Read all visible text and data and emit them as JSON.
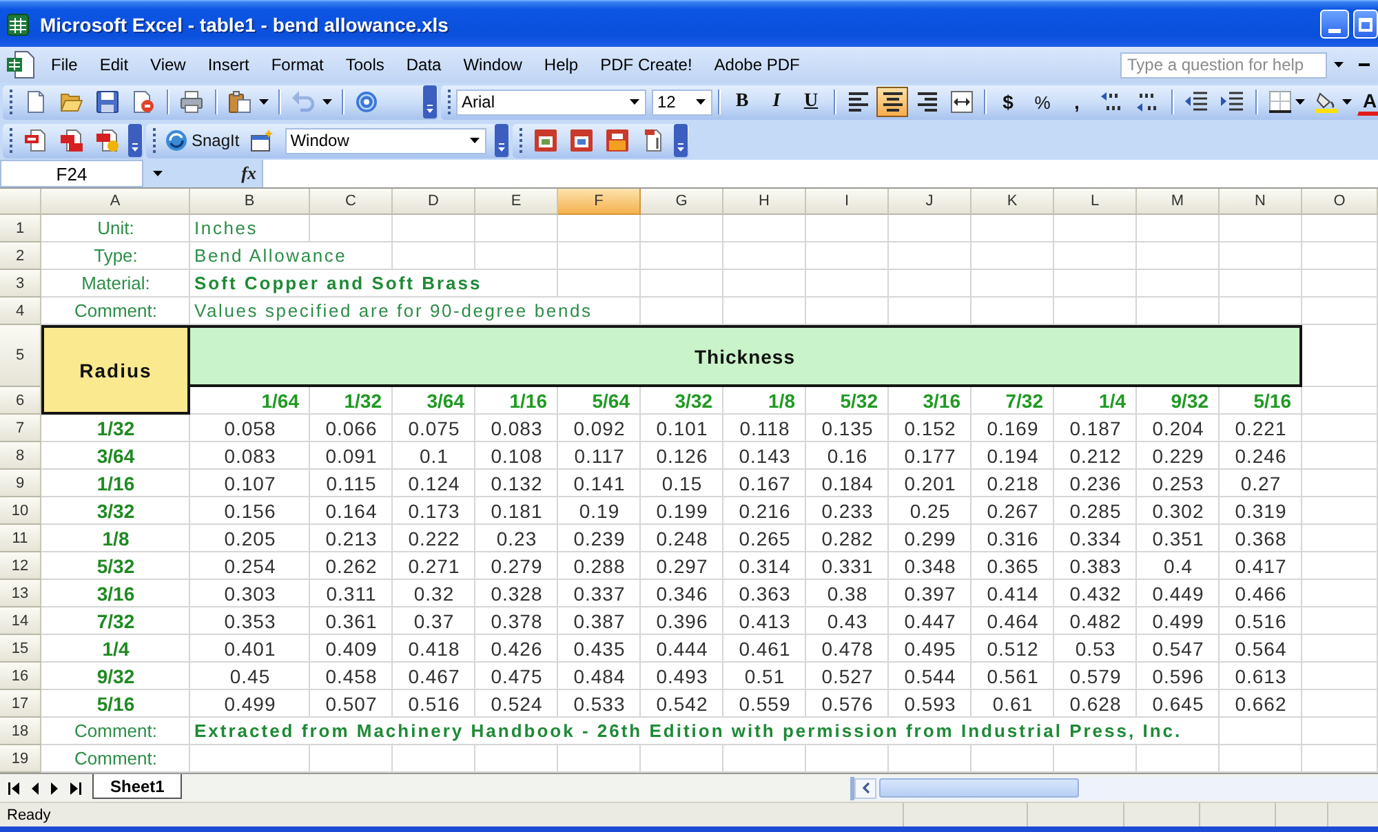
{
  "window": {
    "title": "Microsoft Excel - table1 - bend allowance.xls"
  },
  "menu_bar": {
    "items": [
      "File",
      "Edit",
      "View",
      "Insert",
      "Format",
      "Tools",
      "Data",
      "Window",
      "Help",
      "PDF Create!",
      "Adobe PDF"
    ],
    "help_box": {
      "placeholder": "Type a question for help"
    }
  },
  "standard_toolbar": {
    "undo": {
      "disabled": true
    }
  },
  "formatting_toolbar": {
    "font": "Arial",
    "font_size": "12",
    "style_buttons": [
      {
        "label": "B",
        "selected": false
      },
      {
        "label": "I",
        "selected": false
      },
      {
        "label": "U",
        "selected": false
      }
    ],
    "alignment_buttons": [
      {
        "kind": "left",
        "selected": false
      },
      {
        "kind": "center",
        "selected": true
      },
      {
        "kind": "right",
        "selected": false
      },
      {
        "kind": "merge",
        "selected": false
      }
    ],
    "number_buttons": [
      "$",
      "%",
      ","
    ],
    "font_color_button": "A"
  },
  "snagit_toolbar": {
    "label": "SnagIt",
    "capture_mode": "Window"
  },
  "formula_bar": {
    "name_box": "F24",
    "function_label": "fx"
  },
  "sheet": {
    "columns": [
      {
        "label": "A",
        "selected": false
      },
      {
        "label": "B",
        "selected": false
      },
      {
        "label": "C",
        "selected": false
      },
      {
        "label": "D",
        "selected": false
      },
      {
        "label": "E",
        "selected": false
      },
      {
        "label": "F",
        "selected": true
      },
      {
        "label": "G",
        "selected": false
      },
      {
        "label": "H",
        "selected": false
      },
      {
        "label": "I",
        "selected": false
      },
      {
        "label": "J",
        "selected": false
      },
      {
        "label": "K",
        "selected": false
      },
      {
        "label": "L",
        "selected": false
      },
      {
        "label": "M",
        "selected": false
      },
      {
        "label": "N",
        "selected": false
      },
      {
        "label": "O",
        "selected": false
      }
    ],
    "rows": [
      {
        "number": "1",
        "kind": "info",
        "label": "Unit:",
        "value": "Inches",
        "bold": false
      },
      {
        "number": "2",
        "kind": "info",
        "label": "Type:",
        "value": "Bend Allowance",
        "bold": false
      },
      {
        "number": "3",
        "kind": "info",
        "label": "Material:",
        "value": "Soft Copper and Soft Brass",
        "bold": true
      },
      {
        "number": "4",
        "kind": "info",
        "label": "Comment:",
        "value": "Values specified are for 90-degree bends",
        "bold": false
      },
      {
        "number": "5",
        "kind": "heading",
        "corner": "Radius",
        "title": "Thickness"
      },
      {
        "number": "6",
        "kind": "thickness",
        "values": [
          "1/64",
          "1/32",
          "3/64",
          "1/16",
          "5/64",
          "3/32",
          "1/8",
          "5/32",
          "3/16",
          "7/32",
          "1/4",
          "9/32",
          "5/16"
        ]
      },
      {
        "number": "7",
        "kind": "data",
        "radius": "1/32",
        "values": [
          "0.058",
          "0.066",
          "0.075",
          "0.083",
          "0.092",
          "0.101",
          "0.118",
          "0.135",
          "0.152",
          "0.169",
          "0.187",
          "0.204",
          "0.221"
        ]
      },
      {
        "number": "8",
        "kind": "data",
        "radius": "3/64",
        "values": [
          "0.083",
          "0.091",
          "0.1",
          "0.108",
          "0.117",
          "0.126",
          "0.143",
          "0.16",
          "0.177",
          "0.194",
          "0.212",
          "0.229",
          "0.246"
        ]
      },
      {
        "number": "9",
        "kind": "data",
        "radius": "1/16",
        "values": [
          "0.107",
          "0.115",
          "0.124",
          "0.132",
          "0.141",
          "0.15",
          "0.167",
          "0.184",
          "0.201",
          "0.218",
          "0.236",
          "0.253",
          "0.27"
        ]
      },
      {
        "number": "10",
        "kind": "data",
        "radius": "3/32",
        "values": [
          "0.156",
          "0.164",
          "0.173",
          "0.181",
          "0.19",
          "0.199",
          "0.216",
          "0.233",
          "0.25",
          "0.267",
          "0.285",
          "0.302",
          "0.319"
        ]
      },
      {
        "number": "11",
        "kind": "data",
        "radius": "1/8",
        "values": [
          "0.205",
          "0.213",
          "0.222",
          "0.23",
          "0.239",
          "0.248",
          "0.265",
          "0.282",
          "0.299",
          "0.316",
          "0.334",
          "0.351",
          "0.368"
        ]
      },
      {
        "number": "12",
        "kind": "data",
        "radius": "5/32",
        "values": [
          "0.254",
          "0.262",
          "0.271",
          "0.279",
          "0.288",
          "0.297",
          "0.314",
          "0.331",
          "0.348",
          "0.365",
          "0.383",
          "0.4",
          "0.417"
        ]
      },
      {
        "number": "13",
        "kind": "data",
        "radius": "3/16",
        "values": [
          "0.303",
          "0.311",
          "0.32",
          "0.328",
          "0.337",
          "0.346",
          "0.363",
          "0.38",
          "0.397",
          "0.414",
          "0.432",
          "0.449",
          "0.466"
        ]
      },
      {
        "number": "14",
        "kind": "data",
        "radius": "7/32",
        "values": [
          "0.353",
          "0.361",
          "0.37",
          "0.378",
          "0.387",
          "0.396",
          "0.413",
          "0.43",
          "0.447",
          "0.464",
          "0.482",
          "0.499",
          "0.516"
        ]
      },
      {
        "number": "15",
        "kind": "data",
        "radius": "1/4",
        "values": [
          "0.401",
          "0.409",
          "0.418",
          "0.426",
          "0.435",
          "0.444",
          "0.461",
          "0.478",
          "0.495",
          "0.512",
          "0.53",
          "0.547",
          "0.564"
        ]
      },
      {
        "number": "16",
        "kind": "data",
        "radius": "9/32",
        "values": [
          "0.45",
          "0.458",
          "0.467",
          "0.475",
          "0.484",
          "0.493",
          "0.51",
          "0.527",
          "0.544",
          "0.561",
          "0.579",
          "0.596",
          "0.613"
        ]
      },
      {
        "number": "17",
        "kind": "data",
        "radius": "5/16",
        "values": [
          "0.499",
          "0.507",
          "0.516",
          "0.524",
          "0.533",
          "0.542",
          "0.559",
          "0.576",
          "0.593",
          "0.61",
          "0.628",
          "0.645",
          "0.662"
        ]
      },
      {
        "number": "18",
        "kind": "info",
        "label": "Comment:",
        "value": "Extracted from Machinery Handbook - 26th Edition with permission from Industrial Press, Inc.",
        "bold": true
      },
      {
        "number": "19",
        "kind": "info",
        "label": "Comment:"
      }
    ]
  },
  "sheet_tabs": [
    {
      "label": "Sheet1",
      "selected": true
    }
  ],
  "status_bar": {
    "text": "Ready"
  }
}
